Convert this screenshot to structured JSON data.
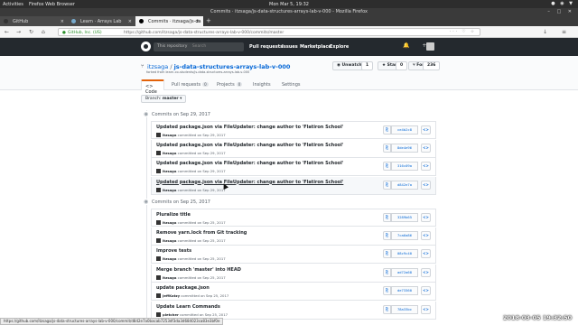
{
  "system": {
    "activities": "Activities",
    "app_name": "Firefox Web Browser",
    "clock": "Mon Mar 5, 19:32",
    "tray": "● ◉ ▼"
  },
  "window": {
    "title": "Commits · itzsaga/js-data-structures-arrays-lab-v-000 - Mozilla Firefox",
    "controls": "– □ ✕"
  },
  "tabs": [
    {
      "label": "GitHub"
    },
    {
      "label": "Learn · Arrays Lab"
    },
    {
      "label": "Commits · itzsaga/js-da"
    }
  ],
  "new_tab": "+",
  "navbar": {
    "back": "←",
    "forward": "→",
    "reload": "↻",
    "home": "⌂",
    "lock": "🔒",
    "secure_label": "GitHub, Inc. (US)",
    "url": "https://github.com/itzsaga/js-data-structures-arrays-lab-v-000/commits/master",
    "more": "··· ♡ ☆",
    "right_icons": "↓ ≡"
  },
  "github_header": {
    "search_placeholder": "This repository",
    "search_hint": "Search",
    "nav": [
      "Pull requests",
      "Issues",
      "Marketplace",
      "Explore"
    ],
    "right_icons": "🔔 +"
  },
  "repo": {
    "owner": "itzsaga",
    "separator": " / ",
    "name": "js-data-structures-arrays-lab-v-000",
    "forked_from": "forked from learn-co-students/js-data-structures-arrays-lab-v-000",
    "unwatch_label": "◉ Unwatch ▾",
    "unwatch_count": "1",
    "star_label": "★ Star",
    "star_count": "0",
    "fork_label": "⑂ Fork",
    "fork_count": "236",
    "tabs": [
      {
        "label": "<> Code",
        "count": ""
      },
      {
        "label": "Pull requests",
        "count": "0"
      },
      {
        "label": "Projects",
        "count": "0"
      },
      {
        "label": "Insights",
        "count": ""
      },
      {
        "label": "Settings",
        "count": ""
      }
    ]
  },
  "branch": {
    "prefix": "Branch:",
    "name": "master",
    "caret": "▾"
  },
  "groups": [
    {
      "heading": "Commits on Sep 29, 2017",
      "commits": [
        {
          "title": "Updated package.json via FileUpdater: change author to 'Flatiron School'",
          "author": "itzsaga",
          "meta": "committed on Sep 29, 2017",
          "sha": "ce4b2c8"
        },
        {
          "title": "Updated package.json via FileUpdater: change author to 'Flatiron School'",
          "author": "itzsaga",
          "meta": "committed on Sep 29, 2017",
          "sha": "8de4e96"
        },
        {
          "title": "Updated package.json via FileUpdater: change author to 'Flatiron School'",
          "author": "itzsaga",
          "meta": "committed on Sep 29, 2017",
          "sha": "316c09a"
        },
        {
          "title": "Updated package.json via FileUpdater: change author to 'Flatiron School'",
          "author": "itzsaga",
          "meta": "committed on Sep 29, 2017",
          "sha": "d842e7a"
        }
      ]
    },
    {
      "heading": "Commits on Sep 25, 2017",
      "commits": [
        {
          "title": "Pluralize title",
          "author": "itzsaga",
          "meta": "committed on Sep 25, 2017",
          "sha": "3289b65"
        },
        {
          "title": "Remove yarn.lock from Git tracking",
          "author": "itzsaga",
          "meta": "committed on Sep 25, 2017",
          "sha": "7ca6a86"
        },
        {
          "title": "Improve tests",
          "author": "itzsaga",
          "meta": "committed on Sep 25, 2017",
          "sha": "08c9c40"
        },
        {
          "title": "Merge branch 'master' into HEAD",
          "author": "itzsaga",
          "meta": "committed on Sep 25, 2017",
          "sha": "ad72a68"
        },
        {
          "title": "update package.json",
          "author": "JeffKatzy",
          "meta": "committed on Sep 25, 2017",
          "sha": "de73360"
        },
        {
          "title": "Update Learn Commands",
          "author": "pletcher",
          "meta": "committed on Sep 25, 2017",
          "sha": "78a33bc"
        }
      ]
    }
  ],
  "icons": {
    "clipboard": "⎘",
    "browse": "<>",
    "repo": "⑂",
    "commit_dot": "◉"
  },
  "status_url": "https://github.com/itzsaga/js-data-structures-arrays-lab-v-000/commit/d842e7a0bacab7253df3da3d684023ca83e3bf0e",
  "screen_timestamp": "2018-03-05  19:32:50"
}
